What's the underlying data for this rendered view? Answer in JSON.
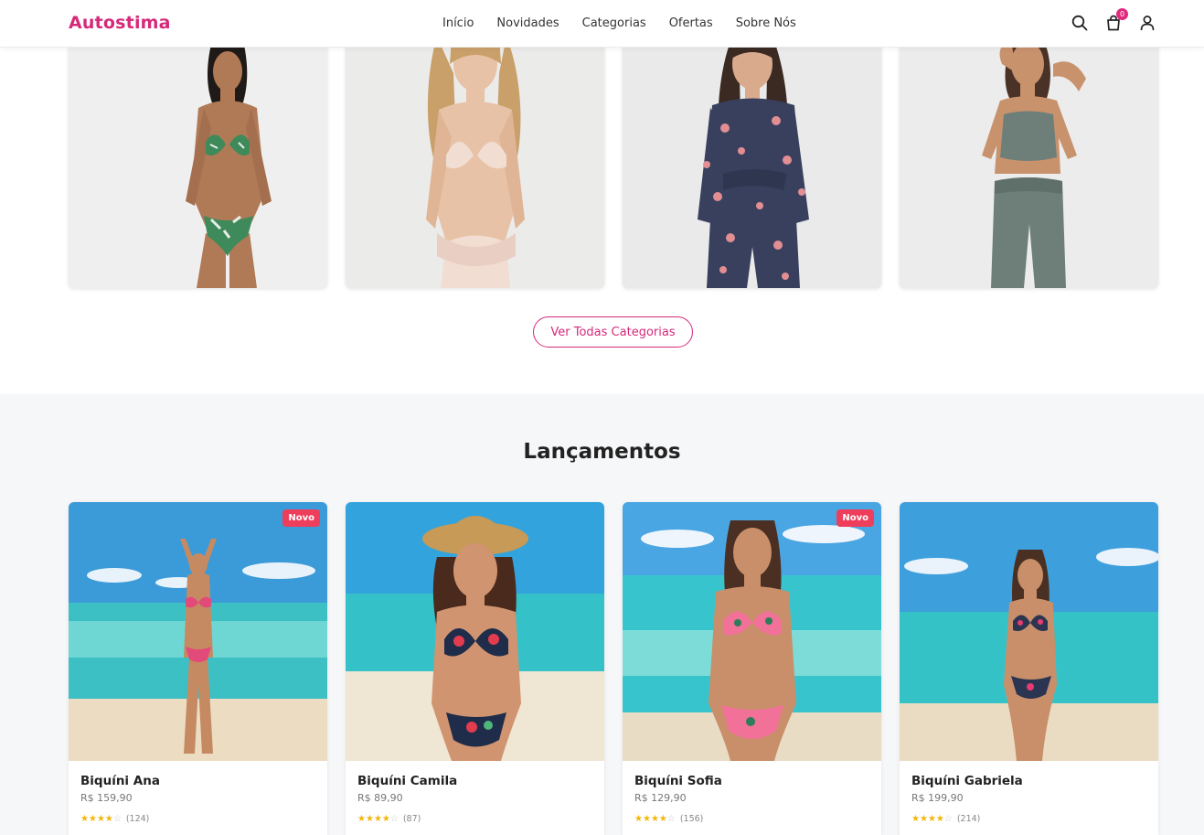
{
  "brand": {
    "logo": "Autostima",
    "accent": "#d6297a"
  },
  "nav": {
    "items": [
      "Início",
      "Novidades",
      "Categorias",
      "Ofertas",
      "Sobre Nós"
    ]
  },
  "header_icons": {
    "search": "search-icon",
    "cart": "shopping-bag-icon",
    "cart_count": "0",
    "account": "user-icon"
  },
  "categories": {
    "images": [
      "bikini-model-photo",
      "lingerie-model-photo",
      "pajama-model-photo",
      "fitness-model-photo"
    ],
    "cta_label": "Ver Todas Categorias"
  },
  "launches": {
    "title": "Lançamentos",
    "products": [
      {
        "name": "Biquíni Ana",
        "price": "R$ 159,90",
        "rating": 4,
        "reviews": "(124)",
        "badge": "Novo"
      },
      {
        "name": "Biquíni Camila",
        "price": "R$ 89,90",
        "rating": 4,
        "reviews": "(87)",
        "badge": ""
      },
      {
        "name": "Biquíni Sofia",
        "price": "R$ 129,90",
        "rating": 4,
        "reviews": "(156)",
        "badge": "Novo"
      },
      {
        "name": "Biquíni Gabriela",
        "price": "R$ 199,90",
        "rating": 4,
        "reviews": "(214)",
        "badge": ""
      }
    ]
  },
  "colors": {
    "badge_new": "#ef3e5c",
    "star": "#f5b50a",
    "section_bg": "#f6f7f9"
  }
}
